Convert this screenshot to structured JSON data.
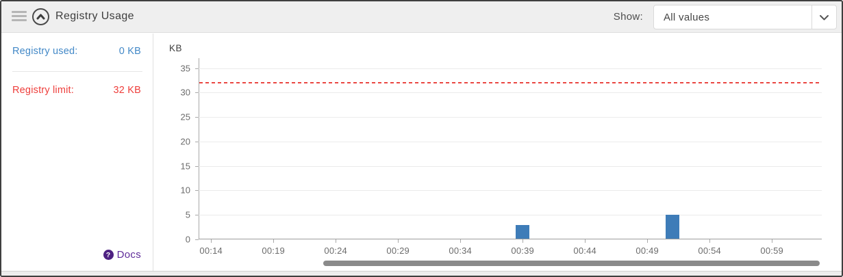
{
  "header": {
    "title": "Registry Usage",
    "show_label": "Show:",
    "show_value": "All values"
  },
  "sidebar": {
    "used_label": "Registry used:",
    "used_value": "0 KB",
    "limit_label": "Registry limit:",
    "limit_value": "32 KB",
    "docs_label": "Docs",
    "docs_icon_glyph": "?"
  },
  "colors": {
    "used_blue": "#4288c7",
    "limit_red": "#ee3e3b",
    "bar_blue": "#3e7cb8",
    "limit_line_red": "#ea4641",
    "docs_purple": "#5f2c9a",
    "scrollbar_gray": "#8a8a8a"
  },
  "chart_data": {
    "type": "bar",
    "title": "",
    "ylabel": "KB",
    "xlabel": "",
    "grid": true,
    "ylim": [
      0,
      36.5
    ],
    "yticks": [
      0,
      5,
      10,
      15,
      20,
      25,
      30,
      35
    ],
    "x_domain": [
      "00:13",
      "01:03"
    ],
    "x_ticks": [
      "00:14",
      "00:19",
      "00:24",
      "00:29",
      "00:34",
      "00:39",
      "00:44",
      "00:49",
      "00:54",
      "00:59"
    ],
    "bar_width_minutes": 1.1,
    "bars": [
      {
        "time": "00:39",
        "value": 3
      },
      {
        "time": "00:51",
        "value": 5
      }
    ],
    "limit_line": {
      "value": 32,
      "style": "dashed",
      "color": "#ea4641"
    }
  }
}
